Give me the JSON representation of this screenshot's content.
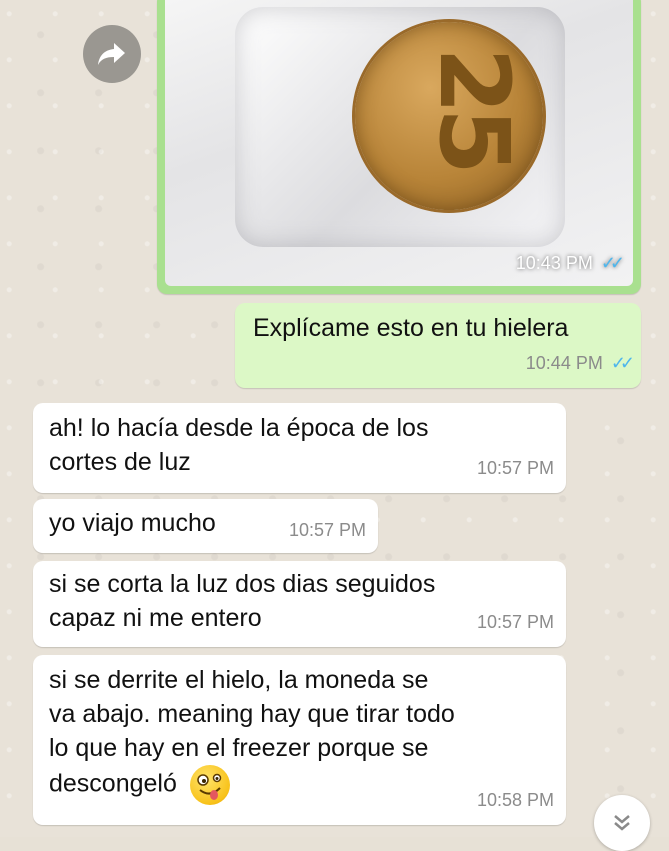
{
  "messages": [
    {
      "type": "image",
      "time": "10:43 PM",
      "direction": "out",
      "ticks": "✓✓",
      "coin_label": "25"
    },
    {
      "type": "text",
      "direction": "out",
      "text": "Explícame esto en tu hielera",
      "time": "10:44 PM",
      "ticks": "✓✓"
    },
    {
      "type": "text",
      "direction": "in",
      "lines": [
        "ah! lo hacía desde la época de los",
        "cortes de luz"
      ],
      "time": "10:57 PM"
    },
    {
      "type": "text",
      "direction": "in",
      "text": "yo viajo mucho",
      "time": "10:57 PM"
    },
    {
      "type": "text",
      "direction": "in",
      "lines": [
        "si se corta la luz dos dias seguidos",
        "capaz ni me entero"
      ],
      "time": "10:57 PM"
    },
    {
      "type": "text",
      "direction": "in",
      "lines": [
        "si se derrite el hielo, la moneda se",
        "va abajo. meaning hay que tirar todo",
        "lo que hay en el freezer porque se",
        "descongeló"
      ],
      "time": "10:58 PM",
      "emoji": "zany-face-emoji"
    }
  ],
  "icons": {
    "forward": "forward-icon",
    "scroll_down": "chevron-double-down-icon"
  },
  "colors": {
    "outgoing_bubble": "#dcf8c6",
    "incoming_bubble": "#ffffff",
    "read_ticks": "#4fb6ec",
    "wallpaper": "#e8e2d8"
  }
}
